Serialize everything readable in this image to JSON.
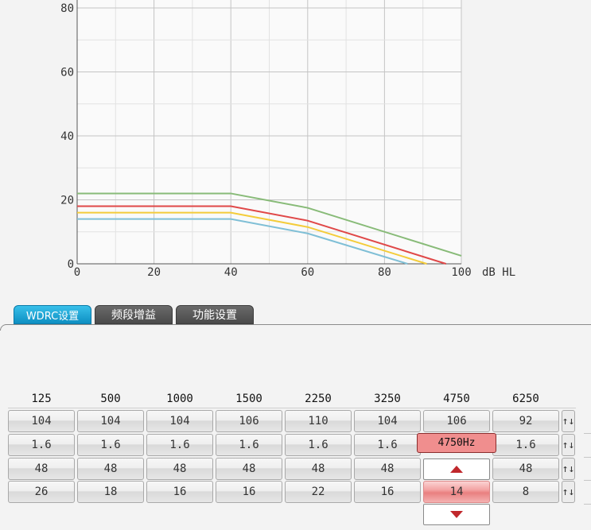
{
  "chart_data": {
    "type": "line",
    "x_unit": "dB HL",
    "xlim": [
      0,
      100
    ],
    "ylim": [
      0,
      80
    ],
    "x_ticks": [
      "0",
      "20",
      "40",
      "60",
      "80",
      "100"
    ],
    "y_ticks": [
      "0",
      "20",
      "40",
      "60",
      "80"
    ],
    "grid": true,
    "series": [
      {
        "color": "#88bb78",
        "points": [
          [
            0,
            22
          ],
          [
            40,
            22
          ],
          [
            60,
            17.5
          ],
          [
            100,
            2.5
          ]
        ]
      },
      {
        "color": "#e04848",
        "points": [
          [
            0,
            18
          ],
          [
            40,
            18
          ],
          [
            60,
            13.5
          ],
          [
            96,
            0
          ]
        ]
      },
      {
        "color": "#f4cc3a",
        "points": [
          [
            0,
            16
          ],
          [
            40,
            16
          ],
          [
            60,
            11.5
          ],
          [
            91,
            0
          ]
        ]
      },
      {
        "color": "#7fbfd6",
        "points": [
          [
            0,
            14
          ],
          [
            40,
            14
          ],
          [
            60,
            9.5
          ],
          [
            86,
            0
          ]
        ]
      }
    ]
  },
  "tabs": [
    {
      "label": "WDRC设置",
      "active": true
    },
    {
      "label": "频段增益",
      "active": false
    },
    {
      "label": "功能设置",
      "active": false
    }
  ],
  "table": {
    "headers": [
      "125",
      "500",
      "1000",
      "1500",
      "2250",
      "3250",
      "4750",
      "6250"
    ],
    "rows": [
      [
        "104",
        "104",
        "104",
        "106",
        "110",
        "104",
        "106",
        "92"
      ],
      [
        "1.6",
        "1.6",
        "1.6",
        "1.6",
        "1.6",
        "1.6",
        "",
        "1.6"
      ],
      [
        "48",
        "48",
        "48",
        "48",
        "48",
        "48",
        "",
        "48"
      ],
      [
        "26",
        "18",
        "16",
        "16",
        "22",
        "16",
        "14",
        "8"
      ]
    ],
    "row_button_symbol": "↑↓"
  },
  "popup": {
    "freq_label": "4750Hz",
    "up_icon": "triangle-up-icon",
    "down_icon": "triangle-down-icon",
    "accent": "#c0282c"
  }
}
